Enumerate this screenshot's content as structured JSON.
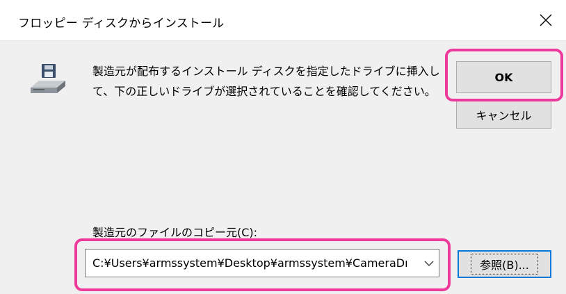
{
  "window": {
    "title": "フロッピー ディスクからインストール"
  },
  "dialog": {
    "message_line1": "製造元が配布するインストール ディスクを指定したドライブに挿入し",
    "message_line2": "て、下の正しいドライブが選択されていることを確認してください。",
    "ok_label": "OK",
    "cancel_label": "キャンセル",
    "copy_from_label": "製造元のファイルのコピー元(C):",
    "copy_from_value": "C:¥Users¥armssystem¥Desktop¥armssystem¥CameraDı",
    "browse_label": "参照(B)..."
  },
  "icons": {
    "disk": "floppy-disk-drive-icon",
    "close": "close-icon",
    "dropdown": "chevron-down-icon"
  },
  "colors": {
    "highlight": "#ee3b9b",
    "focus": "#0078d7"
  }
}
